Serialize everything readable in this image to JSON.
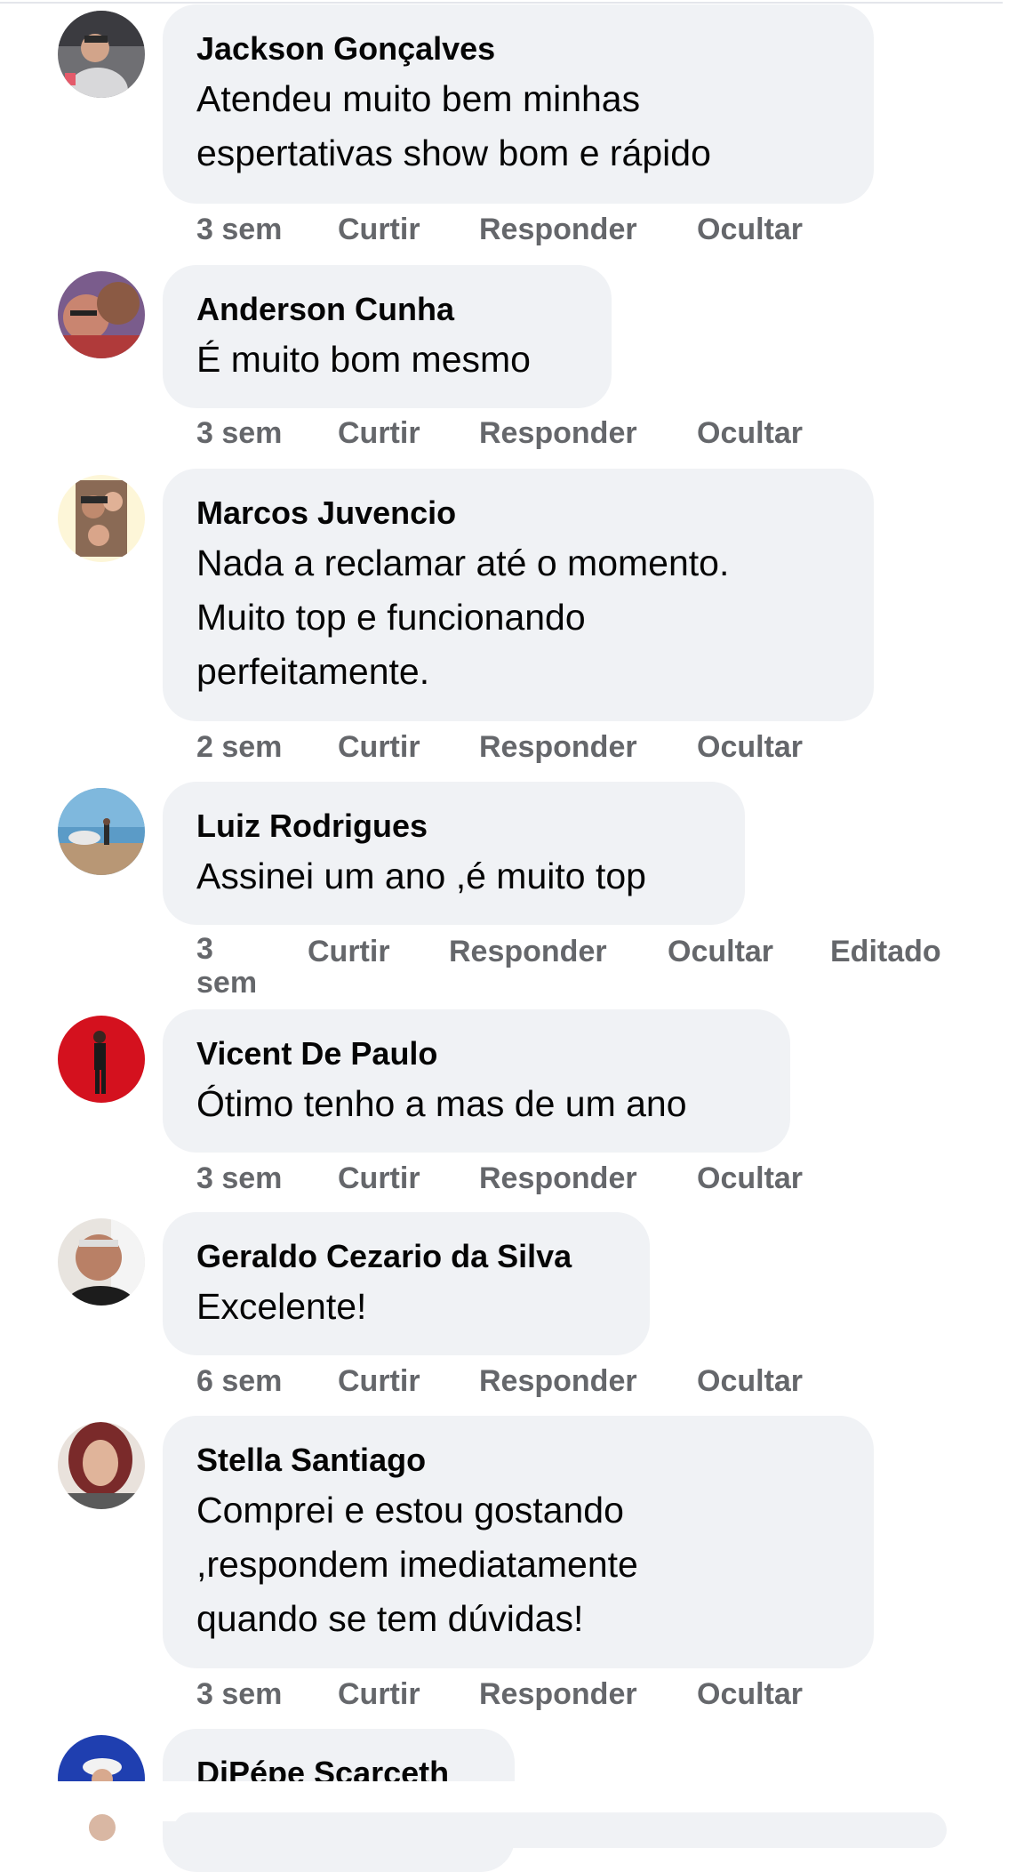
{
  "actions": {
    "like": "Curtir",
    "reply": "Responder",
    "hide": "Ocultar",
    "edited": "Editado"
  },
  "comments": [
    {
      "name": "Jackson Gonçalves",
      "lines": [
        "Atendeu muito bem minhas",
        "espertativas show bom e rápido"
      ],
      "time": "3 sem"
    },
    {
      "name": "Anderson Cunha",
      "lines": [
        "É muito bom mesmo"
      ],
      "time": "3 sem"
    },
    {
      "name": "Marcos Juvencio",
      "lines": [
        "Nada a reclamar até o momento.",
        "Muito top e funcionando",
        "perfeitamente."
      ],
      "time": "2 sem"
    },
    {
      "name": "Luiz Rodrigues",
      "lines": [
        "Assinei um ano ,é muito top"
      ],
      "time": "3 sem"
    },
    {
      "name": "Vicent De Paulo",
      "lines": [
        "Ótimo tenho a mas de um ano"
      ],
      "time": "3 sem"
    },
    {
      "name": "Geraldo Cezario da Silva",
      "lines": [
        "Excelente!"
      ],
      "time": "6 sem"
    },
    {
      "name": "Stella Santiago",
      "lines": [
        "Comprei e estou gostando",
        ",respondem imediatamente",
        "quando se tem dúvidas!"
      ],
      "time": "3 sem"
    },
    {
      "name": "DiPépe Scarceth"
    }
  ]
}
